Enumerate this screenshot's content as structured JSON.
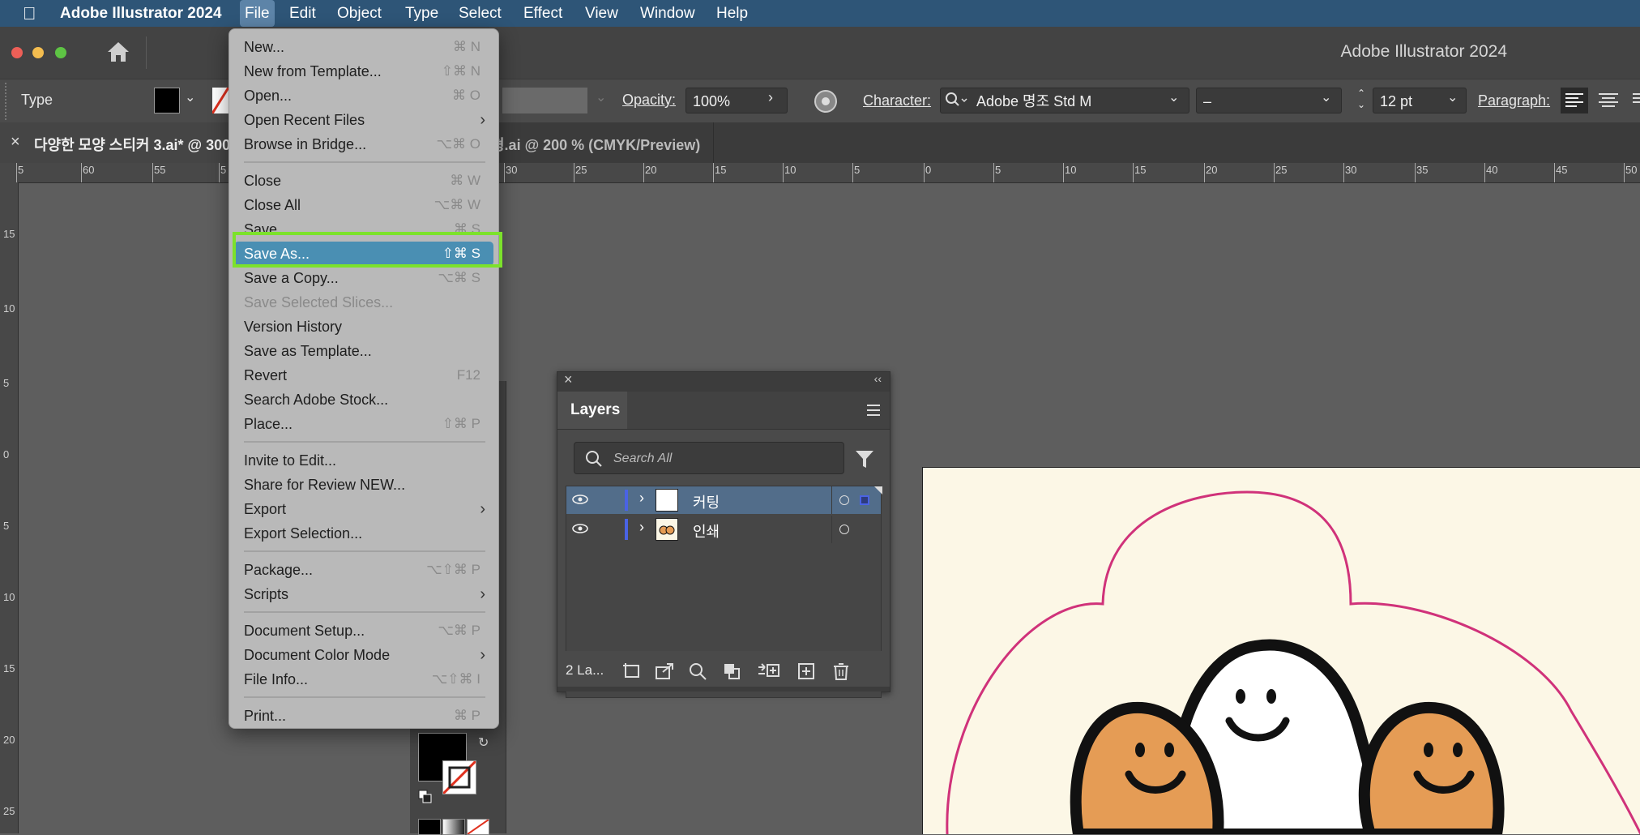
{
  "menubar": {
    "app_name": "Adobe Illustrator 2024",
    "items": [
      "File",
      "Edit",
      "Object",
      "Type",
      "Select",
      "Effect",
      "View",
      "Window",
      "Help"
    ]
  },
  "window": {
    "title": "Adobe Illustrator 2024"
  },
  "control_bar": {
    "tool_label": "Type",
    "opacity_label": "Opacity:",
    "opacity_value": "100%",
    "character_label": "Character:",
    "font_name": "Adobe 명조 Std M",
    "font_style": "–",
    "font_size": "12 pt",
    "paragraph_label": "Paragraph:"
  },
  "doc_tabs": [
    {
      "label": "다양한 모양 스티커 3.ai* @ 300"
    },
    {
      "label": "형.ai @ 200 % (CMYK/Preview)"
    }
  ],
  "ruler": {
    "h_ticks": [
      "5",
      "60",
      "55",
      "5",
      "30",
      "25",
      "20",
      "15",
      "10",
      "5",
      "0",
      "5",
      "10",
      "15",
      "20",
      "25",
      "30",
      "35",
      "40",
      "45",
      "50"
    ],
    "v_ticks": [
      "15",
      "10",
      "5",
      "0",
      "5",
      "10",
      "15",
      "20",
      "25"
    ]
  },
  "file_menu": {
    "items": [
      {
        "label": "New...",
        "shortcut": "⌘ N"
      },
      {
        "label": "New from Template...",
        "shortcut": "⇧⌘ N"
      },
      {
        "label": "Open...",
        "shortcut": "⌘ O"
      },
      {
        "label": "Open Recent Files",
        "shortcut": "",
        "submenu": true
      },
      {
        "label": "Browse in Bridge...",
        "shortcut": "⌥⌘ O"
      },
      {
        "label": "Close",
        "shortcut": "⌘ W"
      },
      {
        "label": "Close All",
        "shortcut": "⌥⌘ W"
      },
      {
        "label": "Save",
        "shortcut": "⌘ S"
      },
      {
        "label": "Save As...",
        "shortcut": "⇧⌘ S",
        "highlighted": true
      },
      {
        "label": "Save a Copy...",
        "shortcut": "⌥⌘ S"
      },
      {
        "label": "Save Selected Slices...",
        "shortcut": "",
        "disabled": true
      },
      {
        "label": "Version History",
        "shortcut": ""
      },
      {
        "label": "Save as Template...",
        "shortcut": ""
      },
      {
        "label": "Revert",
        "shortcut": "F12"
      },
      {
        "label": "Search Adobe Stock...",
        "shortcut": ""
      },
      {
        "label": "Place...",
        "shortcut": "⇧⌘ P"
      },
      {
        "label": "Invite to Edit...",
        "shortcut": ""
      },
      {
        "label": "Share for Review NEW...",
        "shortcut": ""
      },
      {
        "label": "Export",
        "shortcut": "",
        "submenu": true
      },
      {
        "label": "Export Selection...",
        "shortcut": ""
      },
      {
        "label": "Package...",
        "shortcut": "⌥⇧⌘ P"
      },
      {
        "label": "Scripts",
        "shortcut": "",
        "submenu": true
      },
      {
        "label": "Document Setup...",
        "shortcut": "⌥⌘ P"
      },
      {
        "label": "Document Color Mode",
        "shortcut": "",
        "submenu": true
      },
      {
        "label": "File Info...",
        "shortcut": "⌥⇧⌘ I"
      },
      {
        "label": "Print...",
        "shortcut": "⌘ P"
      }
    ]
  },
  "layers_panel": {
    "title": "Layers",
    "search_placeholder": "Search All",
    "layers": [
      {
        "name": "커팅",
        "selected": true
      },
      {
        "name": "인쇄",
        "selected": false
      }
    ],
    "footer_count": "2 La..."
  },
  "colors": {
    "menubar_bg": "#2e5577",
    "highlight": "#4a8fb3",
    "callout": "#7ce22b",
    "layer_color": "#4a63e4",
    "artboard": "#fcf7e6",
    "cut_line": "#d0327a",
    "sticker_orange": "#e59c55"
  }
}
